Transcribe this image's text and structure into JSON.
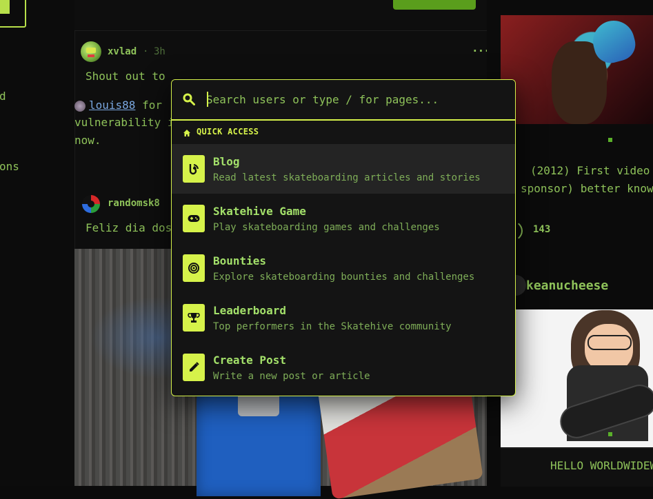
{
  "sidebar": {
    "items": [
      "d",
      "ons"
    ]
  },
  "feed": {
    "posts": [
      {
        "author": "xvlad",
        "time": "3h",
        "text": "Shout out to",
        "reply_mention": "louis88",
        "reply_text_1": " for",
        "reply_text_2": "vulnerability i",
        "reply_text_3": "now."
      },
      {
        "author": "randomsk8",
        "text": "Feliz dia dos"
      }
    ],
    "more_label": "···"
  },
  "right_column": {
    "card1_line1": "(2012) First video",
    "card1_line2": "sponsor) better know",
    "card1_count": "143",
    "card2_author": "keanucheese",
    "card2_caption": "HELLO WORLDWIDEW"
  },
  "palette": {
    "search": {
      "placeholder": "Search users or type / for pages...",
      "value": ""
    },
    "section_label": "QUICK ACCESS",
    "items": [
      {
        "title": "Blog",
        "description": "Read latest skateboarding articles and stories",
        "icon": "blog-icon"
      },
      {
        "title": "Skatehive Game",
        "description": "Play skateboarding games and challenges",
        "icon": "gamepad-icon"
      },
      {
        "title": "Bounties",
        "description": "Explore skateboarding bounties and challenges",
        "icon": "target-icon"
      },
      {
        "title": "Leaderboard",
        "description": "Top performers in the Skatehive community",
        "icon": "trophy-icon"
      },
      {
        "title": "Create Post",
        "description": "Write a new post or article",
        "icon": "pencil-icon"
      }
    ]
  },
  "colors": {
    "accent": "#d6f24a",
    "text": "#8fc35a",
    "background": "#0b0b0b",
    "palette_bg": "#141414"
  }
}
